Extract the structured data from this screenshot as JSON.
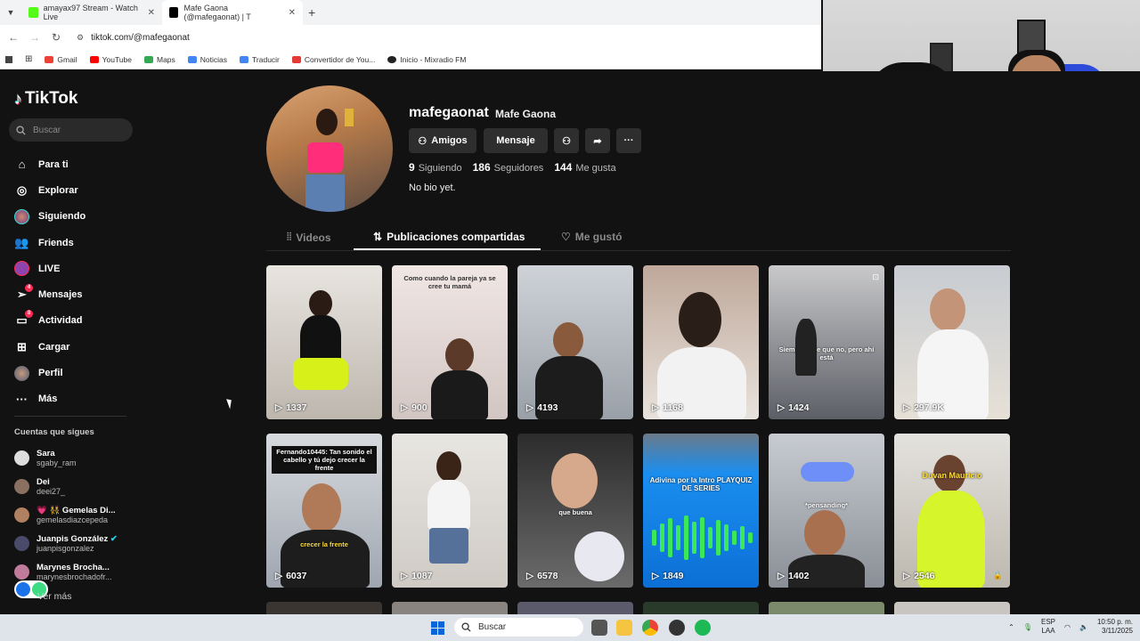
{
  "browser": {
    "tabs": [
      {
        "title": "amayax97 Stream - Watch Live",
        "favicon_color": "#53fc18"
      },
      {
        "title": "Mafe Gaona (@mafegaonat) | T",
        "favicon_color": "#000000"
      }
    ],
    "url": "tiktok.com/@mafegaonat",
    "bookmarks": [
      {
        "label": "Gmail",
        "color": "#ea4335"
      },
      {
        "label": "YouTube",
        "color": "#ff0000"
      },
      {
        "label": "Maps",
        "color": "#34a853"
      },
      {
        "label": "Noticias",
        "color": "#4285f4"
      },
      {
        "label": "Traducir",
        "color": "#4285f4"
      },
      {
        "label": "Convertidor de You...",
        "color": "#e53935"
      },
      {
        "label": "Inicio - Mixradio FM",
        "color": "#222222"
      }
    ]
  },
  "sidebar": {
    "logo": "TikTok",
    "search_placeholder": "Buscar",
    "items": [
      {
        "label": "Para ti",
        "icon": "home-icon"
      },
      {
        "label": "Explorar",
        "icon": "compass-icon"
      },
      {
        "label": "Siguiendo",
        "icon": "following-avatar"
      },
      {
        "label": "Friends",
        "icon": "friends-icon"
      },
      {
        "label": "LIVE",
        "icon": "live-icon"
      },
      {
        "label": "Mensajes",
        "icon": "messages-icon",
        "badge": "4"
      },
      {
        "label": "Actividad",
        "icon": "activity-icon",
        "badge": "8"
      },
      {
        "label": "Cargar",
        "icon": "upload-icon"
      },
      {
        "label": "Perfil",
        "icon": "profile-avatar"
      },
      {
        "label": "Más",
        "icon": "more-icon"
      }
    ],
    "following_title": "Cuentas que sigues",
    "following": [
      {
        "name": "Sara",
        "user": "sgaby_ram"
      },
      {
        "name": "Dei",
        "user": "deei27_"
      },
      {
        "name": "💗 👯 Gemelas Di...",
        "user": "gemelasdiazcepeda"
      },
      {
        "name": "Juanpis González",
        "user": "juanpisgonzalez",
        "verified": true
      },
      {
        "name": "Marynes Brocha...",
        "user": "marynesbrochadofr..."
      }
    ],
    "see_more": "Ver más"
  },
  "profile": {
    "username": "mafegaonat",
    "nickname": "Mafe Gaona",
    "buttons": {
      "friends": "Amigos",
      "message": "Mensaje"
    },
    "stats": {
      "following": "9",
      "following_label": "Siguiendo",
      "followers": "186",
      "followers_label": "Seguidores",
      "likes": "144",
      "likes_label": "Me gusta"
    },
    "bio": "No bio yet."
  },
  "tabs": {
    "videos": "Videos",
    "reposts": "Publicaciones compartidas",
    "liked": "Me gustó"
  },
  "videos": [
    {
      "views": "1337",
      "caption": ""
    },
    {
      "views": "900",
      "caption": "Como cuando la pareja ya se cree tu mamá"
    },
    {
      "views": "4193",
      "caption": ""
    },
    {
      "views": "1168",
      "caption": ""
    },
    {
      "views": "1424",
      "caption": "Siempre dice que no, pero ahí está"
    },
    {
      "views": "297.9K",
      "caption": ""
    },
    {
      "views": "6037",
      "caption": "crecer la frente"
    },
    {
      "views": "1087",
      "caption": ""
    },
    {
      "views": "6578",
      "caption": "que buena"
    },
    {
      "views": "1849",
      "caption": "Adivina por la Intro PLAYQUIZ DE SERIES"
    },
    {
      "views": "1402",
      "caption": "*pensanding*"
    },
    {
      "views": "2546",
      "caption": "Duvan Mauricio"
    }
  ],
  "taskbar": {
    "search": "Buscar",
    "lang1": "ESP",
    "lang2": "LAA",
    "time": "10:50 p. m.",
    "date": "3/11/2025"
  }
}
